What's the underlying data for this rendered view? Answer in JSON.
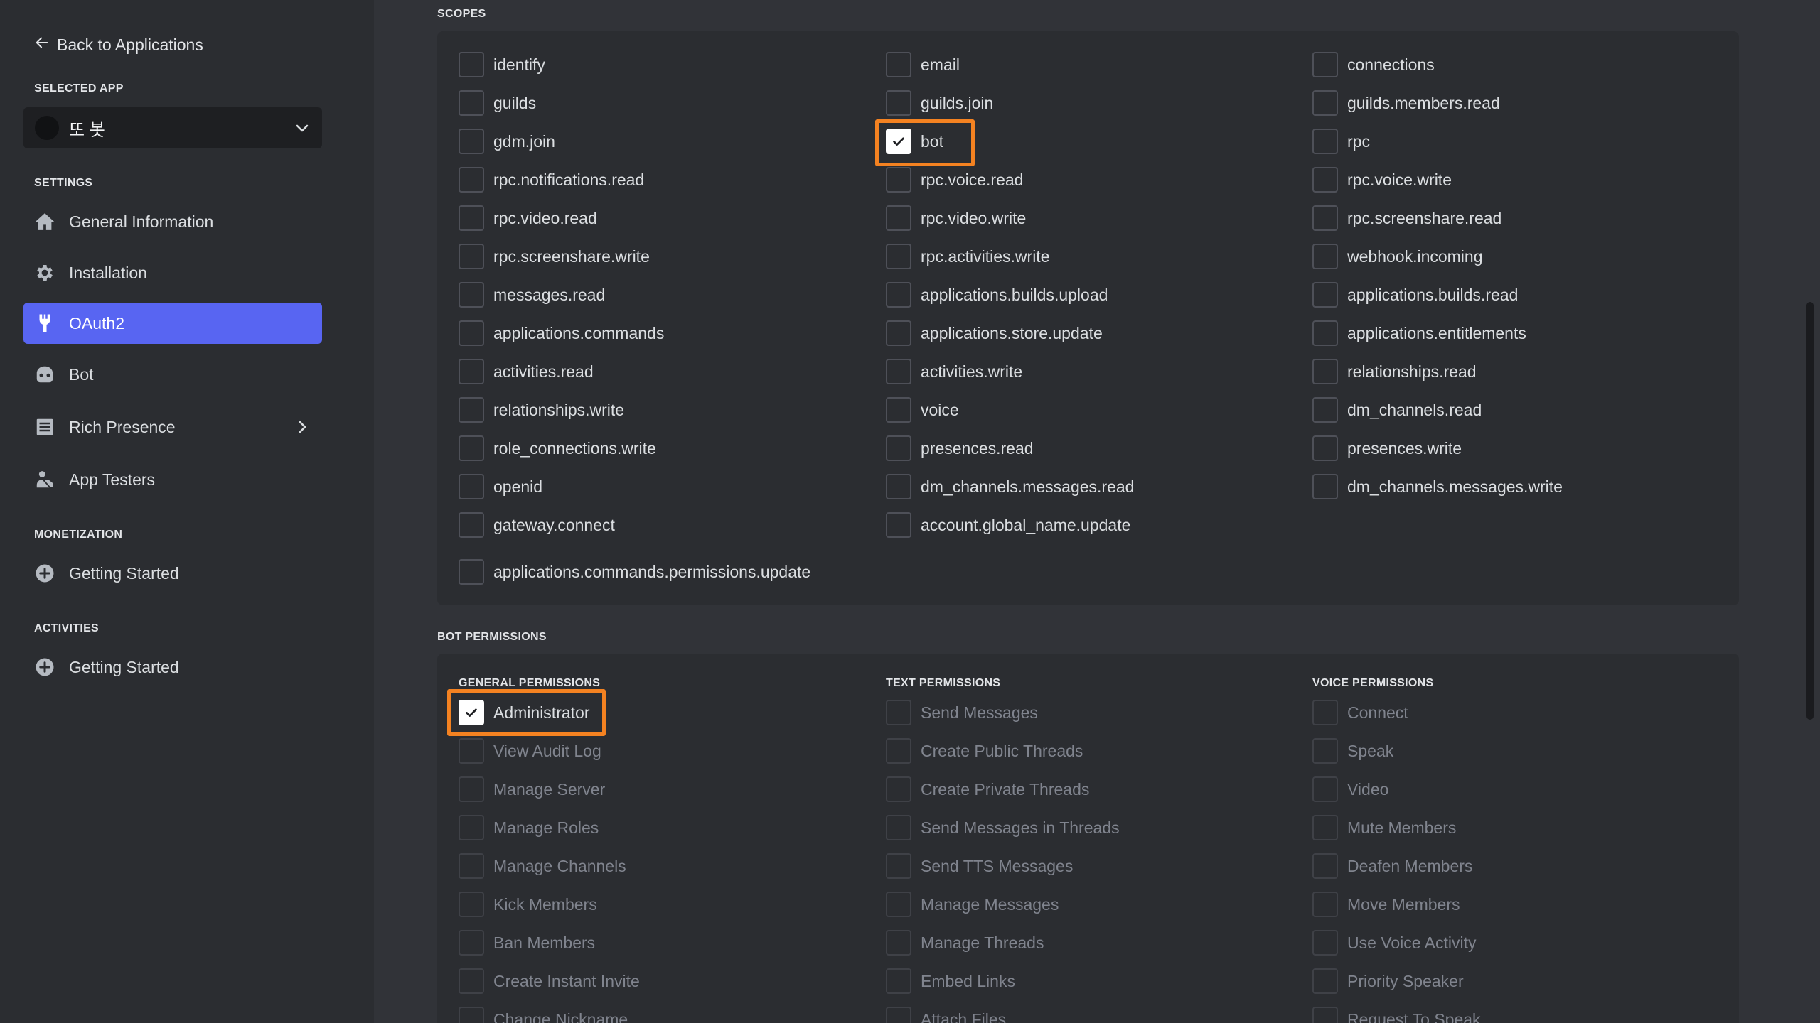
{
  "sidebar": {
    "back_label": "Back to Applications",
    "selected_app_heading": "SELECTED APP",
    "app_name": "또 봇",
    "settings_heading": "SETTINGS",
    "settings_items": [
      {
        "label": "General Information",
        "icon": "home-icon"
      },
      {
        "label": "Installation",
        "icon": "gear-icon"
      },
      {
        "label": "OAuth2",
        "icon": "wrench-icon",
        "active": true
      },
      {
        "label": "Bot",
        "icon": "bot-icon"
      },
      {
        "label": "Rich Presence",
        "icon": "list-icon",
        "expandable": true
      },
      {
        "label": "App Testers",
        "icon": "person-icon"
      }
    ],
    "monetization_heading": "MONETIZATION",
    "monetization_items": [
      {
        "label": "Getting Started",
        "icon": "plus-circle-icon"
      }
    ],
    "activities_heading": "ACTIVITIES",
    "activities_items": [
      {
        "label": "Getting Started",
        "icon": "plus-circle-icon"
      }
    ]
  },
  "scopes": {
    "heading": "SCOPES",
    "columns": [
      [
        "identify",
        "guilds",
        "gdm.join",
        "rpc.notifications.read",
        "rpc.video.read",
        "rpc.screenshare.write",
        "messages.read",
        "applications.commands",
        "activities.read",
        "relationships.write",
        "role_connections.write",
        "openid",
        "gateway.connect"
      ],
      [
        "email",
        "guilds.join",
        "bot",
        "rpc.voice.read",
        "rpc.video.write",
        "rpc.activities.write",
        "applications.builds.upload",
        "applications.store.update",
        "activities.write",
        "voice",
        "presences.read",
        "dm_channels.messages.read",
        "account.global_name.update"
      ],
      [
        "connections",
        "guilds.members.read",
        "rpc",
        "rpc.voice.write",
        "rpc.screenshare.read",
        "webhook.incoming",
        "applications.builds.read",
        "applications.entitlements",
        "relationships.read",
        "dm_channels.read",
        "presences.write",
        "dm_channels.messages.write"
      ]
    ],
    "extra": "applications.commands.permissions.update",
    "checked": [
      "bot"
    ]
  },
  "bot_permissions": {
    "heading": "BOT PERMISSIONS",
    "general_heading": "GENERAL PERMISSIONS",
    "text_heading": "TEXT PERMISSIONS",
    "voice_heading": "VOICE PERMISSIONS",
    "general": [
      "Administrator",
      "View Audit Log",
      "Manage Server",
      "Manage Roles",
      "Manage Channels",
      "Kick Members",
      "Ban Members",
      "Create Instant Invite",
      "Change Nickname"
    ],
    "text": [
      "Send Messages",
      "Create Public Threads",
      "Create Private Threads",
      "Send Messages in Threads",
      "Send TTS Messages",
      "Manage Messages",
      "Manage Threads",
      "Embed Links",
      "Attach Files"
    ],
    "voice": [
      "Connect",
      "Speak",
      "Video",
      "Mute Members",
      "Deafen Members",
      "Move Members",
      "Use Voice Activity",
      "Priority Speaker",
      "Request To Speak"
    ],
    "checked": [
      "Administrator"
    ]
  },
  "colors": {
    "accent": "#5865f2",
    "highlight": "#f48221",
    "background": "#313338",
    "sidebar": "#2b2d31"
  }
}
